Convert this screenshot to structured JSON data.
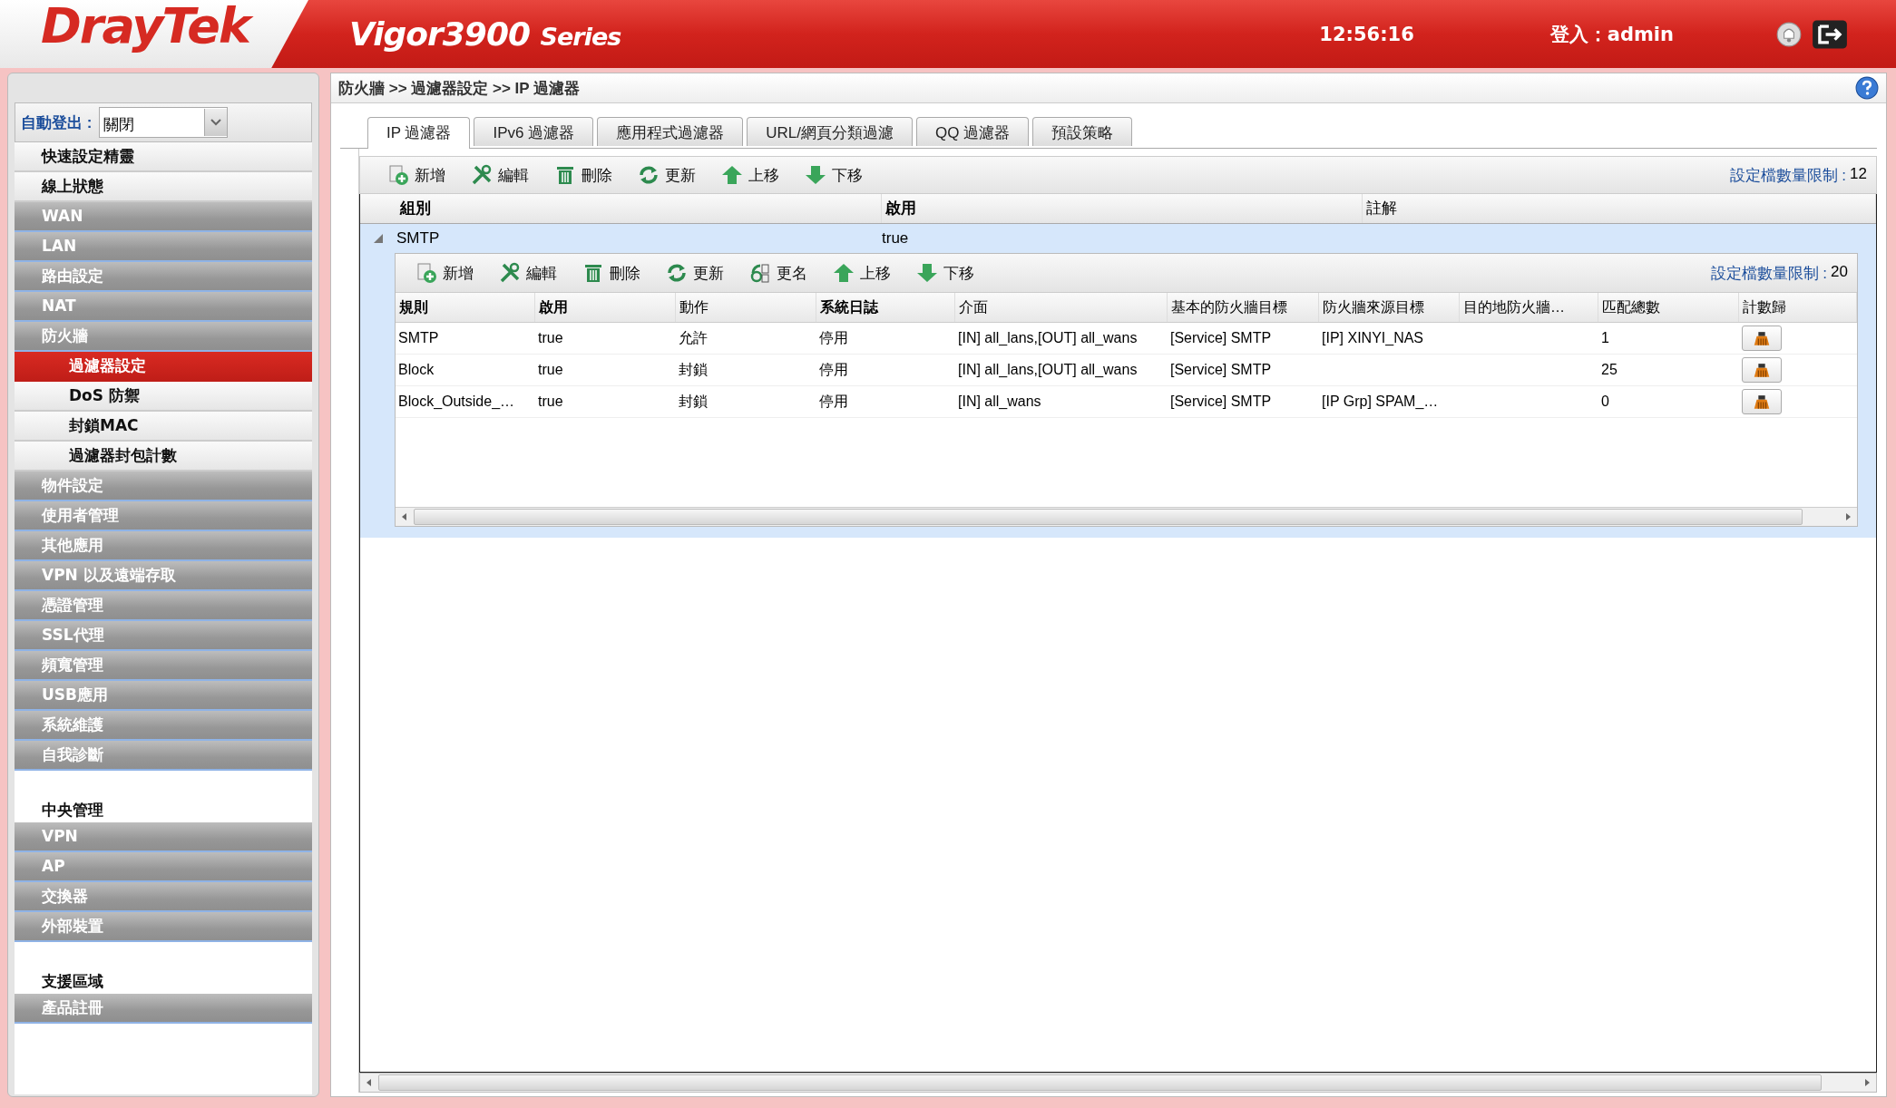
{
  "header": {
    "logo": "DrayTek",
    "product": "Vigor3900",
    "series": "Series",
    "time": "12:56:16",
    "login": "登入：admin"
  },
  "sidebar": {
    "auto_logout_label": "自動登出 :",
    "auto_logout_value": "關閉",
    "items": [
      {
        "label": "快速設定精靈",
        "kind": "light",
        "selected": false
      },
      {
        "label": "線上狀態",
        "kind": "light",
        "selected": false
      },
      {
        "label": "WAN",
        "kind": "dark",
        "selected": false
      },
      {
        "label": "LAN",
        "kind": "dark",
        "selected": false
      },
      {
        "label": "路由設定",
        "kind": "dark",
        "selected": false
      },
      {
        "label": "NAT",
        "kind": "dark",
        "selected": false
      },
      {
        "label": "防火牆",
        "kind": "dark",
        "selected": false
      },
      {
        "label": "過濾器設定",
        "kind": "sub",
        "selected": true
      },
      {
        "label": "DoS 防禦",
        "kind": "sub",
        "selected": false
      },
      {
        "label": "封鎖MAC",
        "kind": "sub",
        "selected": false
      },
      {
        "label": "過濾器封包計數",
        "kind": "sub",
        "selected": false
      },
      {
        "label": "物件設定",
        "kind": "dark",
        "selected": false
      },
      {
        "label": "使用者管理",
        "kind": "dark",
        "selected": false
      },
      {
        "label": "其他應用",
        "kind": "dark",
        "selected": false
      },
      {
        "label": "VPN 以及遠端存取",
        "kind": "dark",
        "selected": false
      },
      {
        "label": "憑證管理",
        "kind": "dark",
        "selected": false
      },
      {
        "label": "SSL代理",
        "kind": "dark",
        "selected": false
      },
      {
        "label": "頻寬管理",
        "kind": "dark",
        "selected": false
      },
      {
        "label": "USB應用",
        "kind": "dark",
        "selected": false
      },
      {
        "label": "系統維護",
        "kind": "dark",
        "selected": false
      },
      {
        "label": "自我診斷",
        "kind": "dark",
        "selected": false
      },
      {
        "label": "中央管理",
        "kind": "section",
        "selected": false
      },
      {
        "label": "VPN",
        "kind": "dark",
        "selected": false
      },
      {
        "label": "AP",
        "kind": "dark",
        "selected": false
      },
      {
        "label": "交換器",
        "kind": "dark",
        "selected": false
      },
      {
        "label": "外部裝置",
        "kind": "dark",
        "selected": false
      },
      {
        "label": "支援區域",
        "kind": "section",
        "selected": false
      },
      {
        "label": "產品註冊",
        "kind": "dark",
        "selected": false
      }
    ]
  },
  "breadcrumb": "防火牆 >> 過濾器設定 >> IP 過濾器",
  "tabs": [
    {
      "label": "IP 過濾器",
      "selected": true
    },
    {
      "label": "IPv6 過濾器",
      "selected": false
    },
    {
      "label": "應用程式過濾器",
      "selected": false
    },
    {
      "label": "URL/網頁分類過濾",
      "selected": false
    },
    {
      "label": "QQ 過濾器",
      "selected": false
    },
    {
      "label": "預設策略",
      "selected": false
    }
  ],
  "toolbar": {
    "buttons": [
      {
        "label": "新增",
        "kind": "add"
      },
      {
        "label": "編輯",
        "kind": "edit"
      },
      {
        "label": "刪除",
        "kind": "delete"
      },
      {
        "label": "更新",
        "kind": "refresh"
      },
      {
        "label": "上移",
        "kind": "up"
      },
      {
        "label": "下移",
        "kind": "down"
      }
    ],
    "limit_label": "設定檔數量限制 :",
    "limit_value": "12"
  },
  "group_table": {
    "columns": [
      "組別",
      "啟用",
      "註解"
    ],
    "groups": [
      {
        "name": "SMTP",
        "enabled": "true",
        "expanded": true,
        "toolbar": {
          "buttons": [
            {
              "label": "新增",
              "kind": "add"
            },
            {
              "label": "編輯",
              "kind": "edit"
            },
            {
              "label": "刪除",
              "kind": "delete"
            },
            {
              "label": "更新",
              "kind": "refresh"
            },
            {
              "label": "更名",
              "kind": "rename"
            },
            {
              "label": "上移",
              "kind": "up"
            },
            {
              "label": "下移",
              "kind": "down"
            }
          ],
          "limit_label": "設定檔數量限制 :",
          "limit_value": "20"
        },
        "columns": [
          "規則",
          "啟用",
          "動作",
          "系統日誌",
          "介面",
          "基本的防火牆目標",
          "防火牆來源目標",
          "目的地防火牆…",
          "匹配總數",
          "計數歸"
        ],
        "rows": [
          [
            "SMTP",
            "true",
            "允許",
            "停用",
            "[IN] all_lans,[OUT] all_wans",
            "[Service] SMTP",
            "[IP] XINYI_NAS",
            "",
            "1"
          ],
          [
            "Block",
            "true",
            "封鎖",
            "停用",
            "[IN] all_lans,[OUT] all_wans",
            "[Service] SMTP",
            "",
            "",
            "25"
          ],
          [
            "Block_Outside_…",
            "true",
            "封鎖",
            "停用",
            "[IN] all_wans",
            "[Service] SMTP",
            "[IP Grp] SPAM_…",
            "",
            "0"
          ]
        ]
      }
    ]
  }
}
